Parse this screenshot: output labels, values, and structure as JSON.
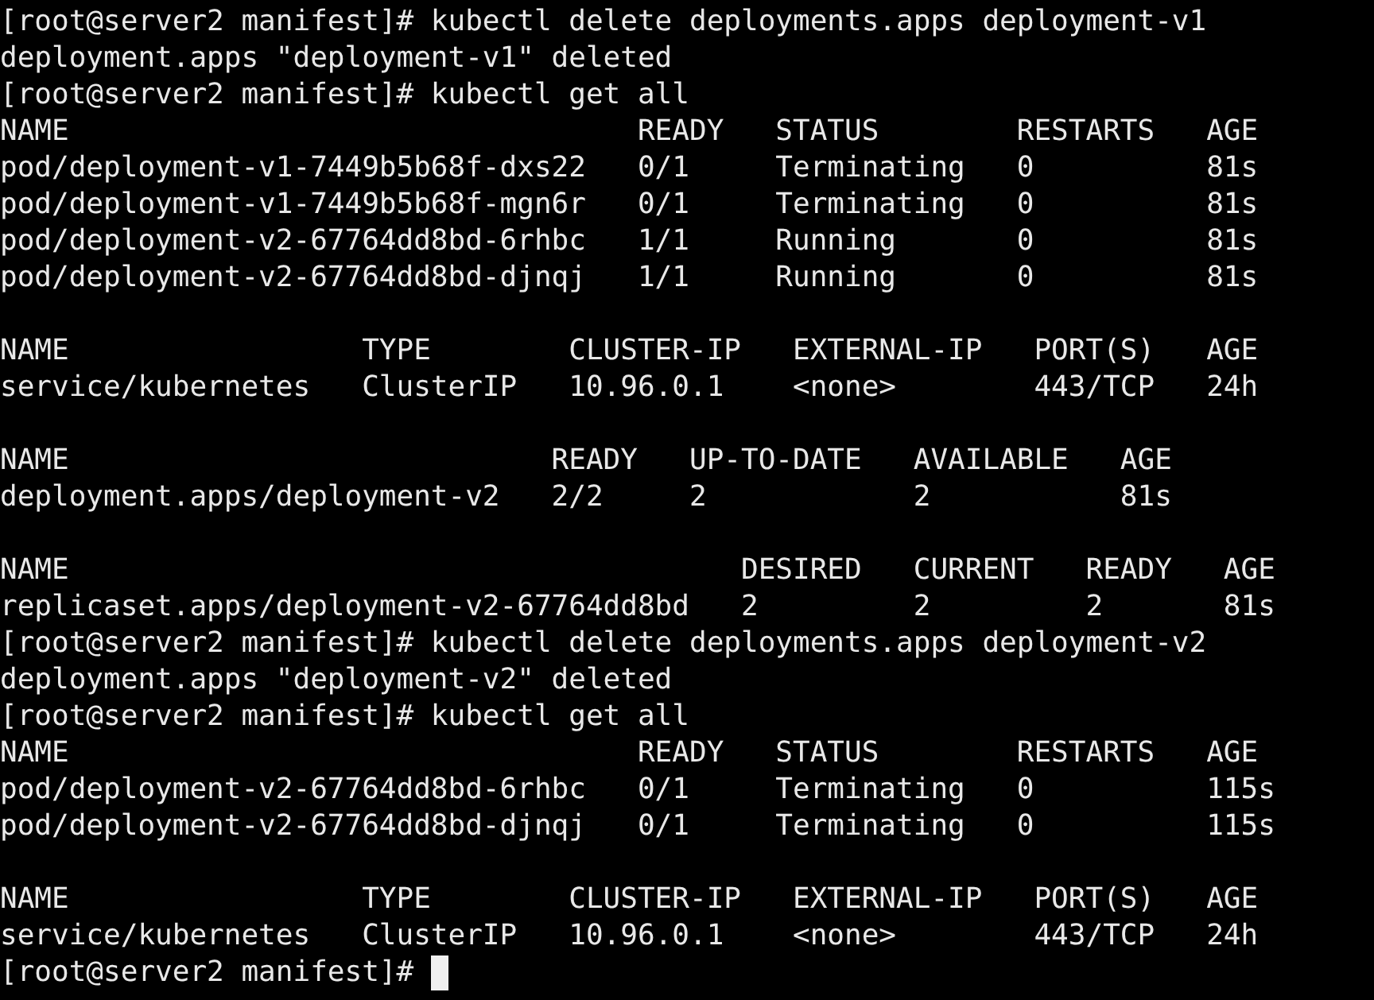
{
  "terminal": {
    "lines": [
      {
        "kind": "prompt",
        "text": "[root@server2 manifest]# kubectl delete deployments.apps deployment-v1",
        "cursor": false
      },
      {
        "kind": "output",
        "text": "deployment.apps \"deployment-v1\" deleted"
      },
      {
        "kind": "prompt",
        "text": "[root@server2 manifest]# kubectl get all",
        "cursor": false
      },
      {
        "kind": "output",
        "text": "NAME                                 READY   STATUS        RESTARTS   AGE"
      },
      {
        "kind": "output",
        "text": "pod/deployment-v1-7449b5b68f-dxs22   0/1     Terminating   0          81s"
      },
      {
        "kind": "output",
        "text": "pod/deployment-v1-7449b5b68f-mgn6r   0/1     Terminating   0          81s"
      },
      {
        "kind": "output",
        "text": "pod/deployment-v2-67764dd8bd-6rhbc   1/1     Running       0          81s"
      },
      {
        "kind": "output",
        "text": "pod/deployment-v2-67764dd8bd-djnqj   1/1     Running       0          81s"
      },
      {
        "kind": "blank"
      },
      {
        "kind": "output",
        "text": "NAME                 TYPE        CLUSTER-IP   EXTERNAL-IP   PORT(S)   AGE"
      },
      {
        "kind": "output",
        "text": "service/kubernetes   ClusterIP   10.96.0.1    <none>        443/TCP   24h"
      },
      {
        "kind": "blank"
      },
      {
        "kind": "output",
        "text": "NAME                            READY   UP-TO-DATE   AVAILABLE   AGE"
      },
      {
        "kind": "output",
        "text": "deployment.apps/deployment-v2   2/2     2            2           81s"
      },
      {
        "kind": "blank"
      },
      {
        "kind": "output",
        "text": "NAME                                       DESIRED   CURRENT   READY   AGE"
      },
      {
        "kind": "output",
        "text": "replicaset.apps/deployment-v2-67764dd8bd   2         2         2       81s"
      },
      {
        "kind": "prompt",
        "text": "[root@server2 manifest]# kubectl delete deployments.apps deployment-v2",
        "cursor": false
      },
      {
        "kind": "output",
        "text": "deployment.apps \"deployment-v2\" deleted"
      },
      {
        "kind": "prompt",
        "text": "[root@server2 manifest]# kubectl get all",
        "cursor": false
      },
      {
        "kind": "output",
        "text": "NAME                                 READY   STATUS        RESTARTS   AGE"
      },
      {
        "kind": "output",
        "text": "pod/deployment-v2-67764dd8bd-6rhbc   0/1     Terminating   0          115s"
      },
      {
        "kind": "output",
        "text": "pod/deployment-v2-67764dd8bd-djnqj   0/1     Terminating   0          115s"
      },
      {
        "kind": "blank"
      },
      {
        "kind": "output",
        "text": "NAME                 TYPE        CLUSTER-IP   EXTERNAL-IP   PORT(S)   AGE"
      },
      {
        "kind": "output",
        "text": "service/kubernetes   ClusterIP   10.96.0.1    <none>        443/TCP   24h"
      },
      {
        "kind": "prompt",
        "text": "[root@server2 manifest]#",
        "cursor": true
      }
    ]
  }
}
